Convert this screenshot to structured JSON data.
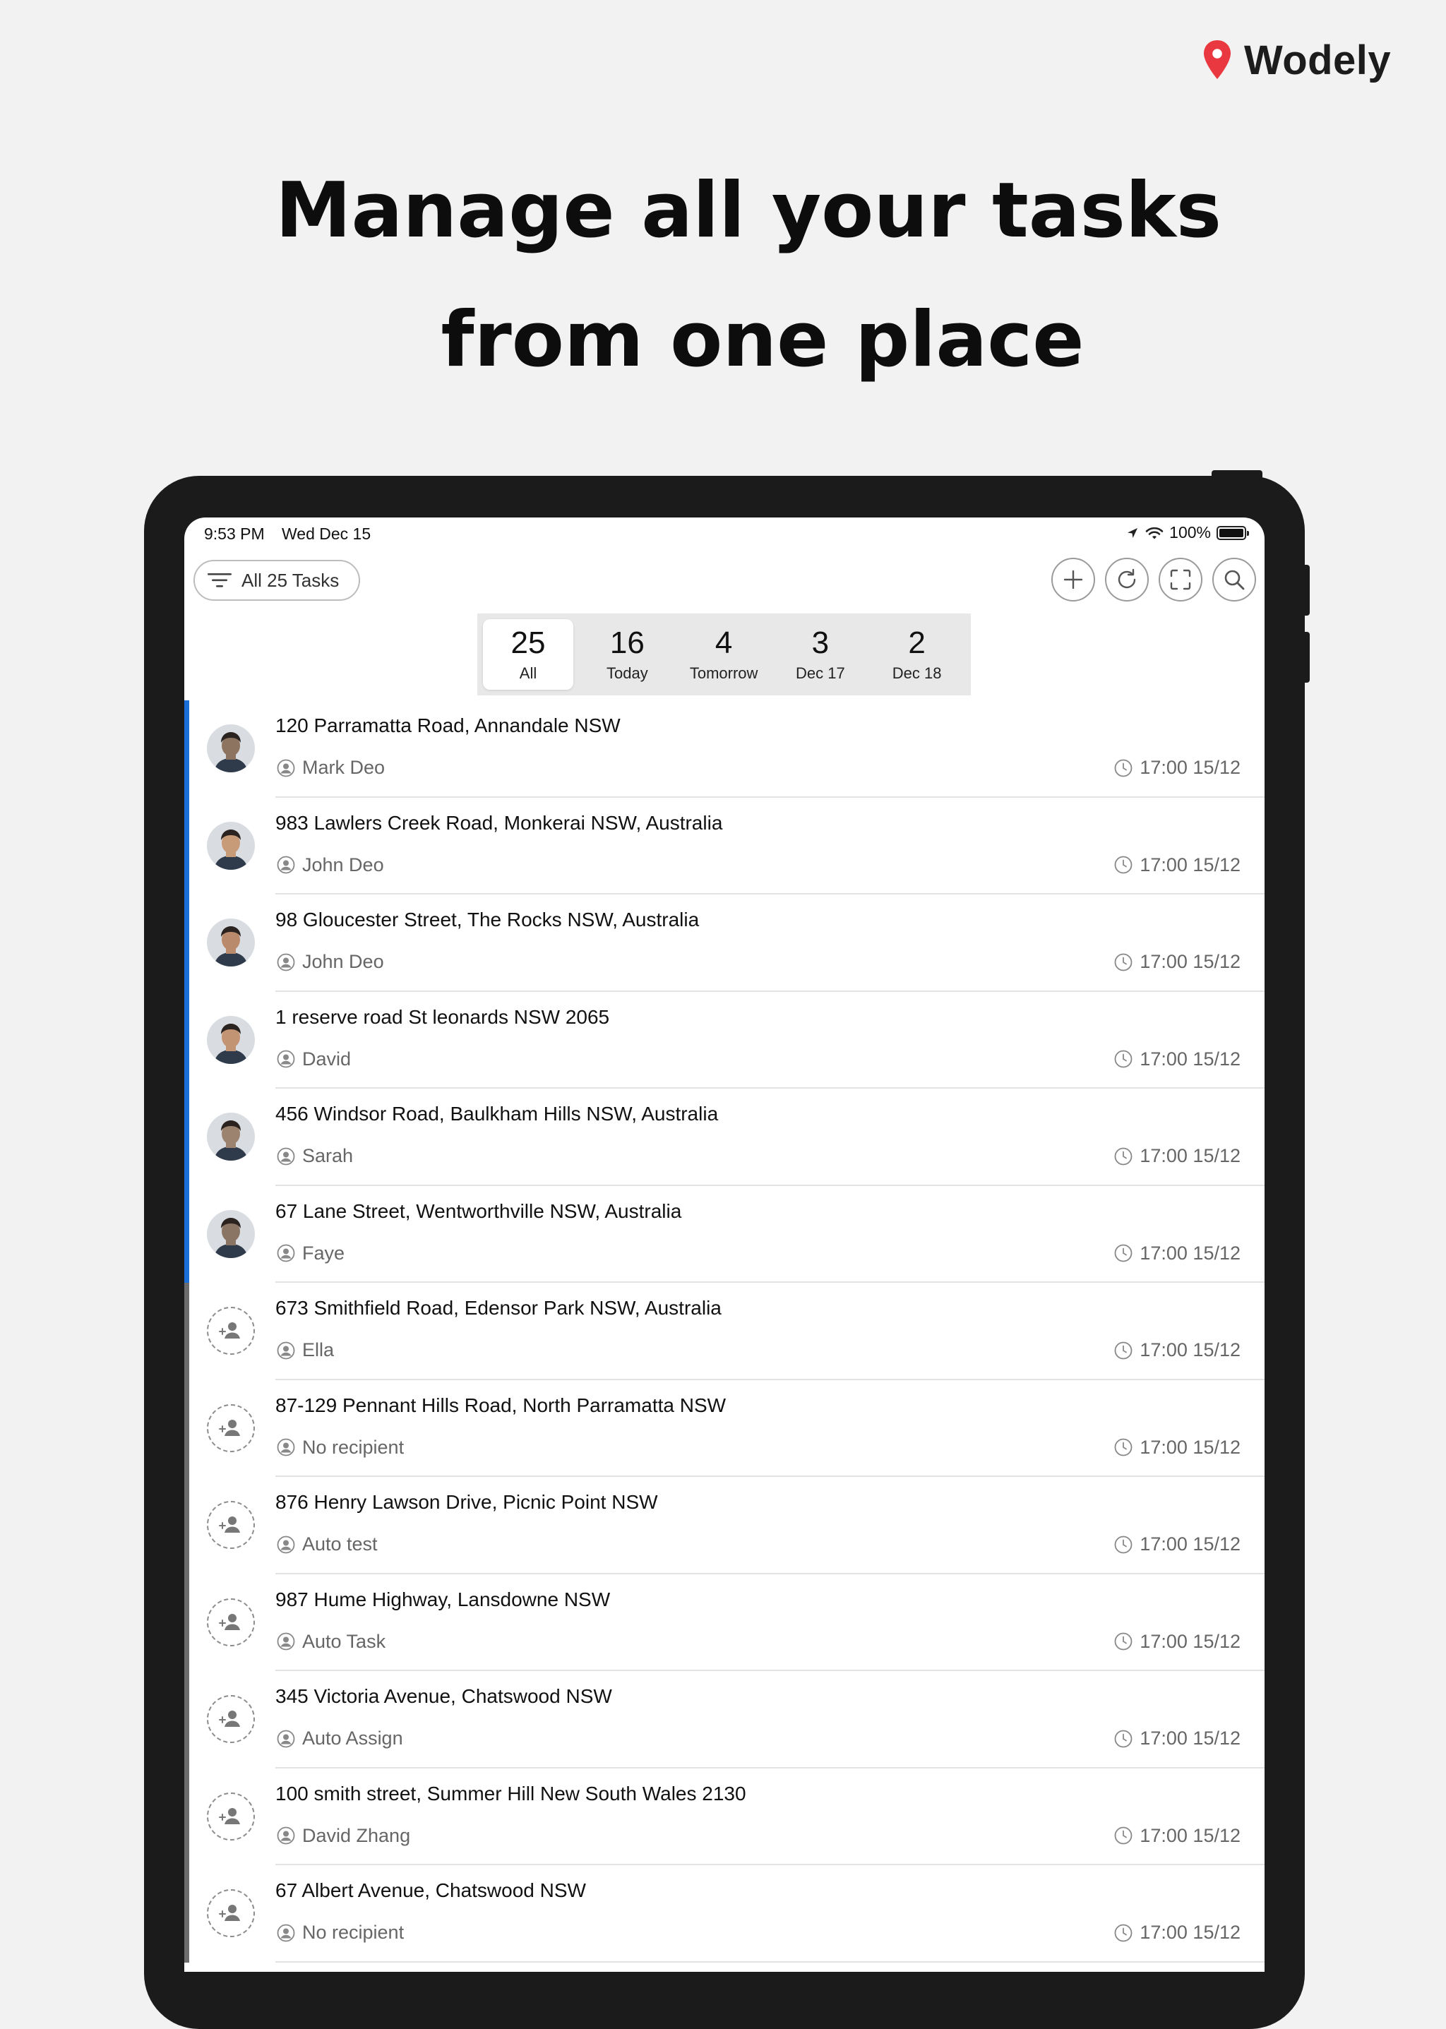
{
  "brand": {
    "name": "Wodely",
    "pin_color": "#e9383f"
  },
  "headline": {
    "line1": "Manage all your tasks",
    "line2": "from one place"
  },
  "status_bar": {
    "time": "9:53 PM",
    "date": "Wed Dec 15",
    "battery": "100%",
    "battery_level": 1.0
  },
  "toolbar": {
    "filter_label": "All 25 Tasks",
    "icons": [
      "add-icon",
      "refresh-icon",
      "fullscreen-icon",
      "search-icon"
    ]
  },
  "segments": [
    {
      "count": "25",
      "label": "All",
      "selected": true
    },
    {
      "count": "16",
      "label": "Today",
      "selected": false
    },
    {
      "count": "4",
      "label": "Tomorrow",
      "selected": false
    },
    {
      "count": "3",
      "label": "Dec 17",
      "selected": false
    },
    {
      "count": "2",
      "label": "Dec 18",
      "selected": false
    }
  ],
  "colors": {
    "accent": "#1a6fd9",
    "unassigned_bar": "#6d6d6d"
  },
  "tasks": [
    {
      "address": "120 Parramatta Road, Annandale NSW",
      "recipient": "Mark Deo",
      "time": "17:00 15/12",
      "assigned": true,
      "avatar_tone": "#8d7460"
    },
    {
      "address": "983 Lawlers Creek Road, Monkerai NSW, Australia",
      "recipient": "John Deo",
      "time": "17:00 15/12",
      "assigned": true,
      "avatar_tone": "#c79a78"
    },
    {
      "address": "98 Gloucester Street, The Rocks NSW, Australia",
      "recipient": "John Deo",
      "time": "17:00 15/12",
      "assigned": true,
      "avatar_tone": "#b98b6c"
    },
    {
      "address": "1 reserve road St leonards NSW 2065",
      "recipient": "David",
      "time": "17:00 15/12",
      "assigned": true,
      "avatar_tone": "#c39473"
    },
    {
      "address": "456 Windsor Road, Baulkham Hills NSW, Australia",
      "recipient": "Sarah",
      "time": "17:00 15/12",
      "assigned": true,
      "avatar_tone": "#9c8370"
    },
    {
      "address": "67 Lane Street, Wentworthville NSW, Australia",
      "recipient": "Faye",
      "time": "17:00 15/12",
      "assigned": true,
      "avatar_tone": "#8a7565"
    },
    {
      "address": "673 Smithfield Road, Edensor Park NSW, Australia",
      "recipient": "Ella",
      "time": "17:00 15/12",
      "assigned": false
    },
    {
      "address": "87-129 Pennant Hills Road, North Parramatta NSW",
      "recipient": "No recipient",
      "time": "17:00 15/12",
      "assigned": false
    },
    {
      "address": "876 Henry Lawson Drive, Picnic Point NSW",
      "recipient": "Auto test",
      "time": "17:00 15/12",
      "assigned": false
    },
    {
      "address": "987 Hume Highway, Lansdowne NSW",
      "recipient": "Auto Task",
      "time": "17:00 15/12",
      "assigned": false
    },
    {
      "address": "345 Victoria Avenue, Chatswood NSW",
      "recipient": "Auto Assign",
      "time": "17:00 15/12",
      "assigned": false
    },
    {
      "address": "100 smith street, Summer Hill New South Wales 2130",
      "recipient": "David Zhang",
      "time": "17:00 15/12",
      "assigned": false
    },
    {
      "address": "67 Albert Avenue, Chatswood NSW",
      "recipient": "No recipient",
      "time": "17:00 15/12",
      "assigned": false
    }
  ]
}
